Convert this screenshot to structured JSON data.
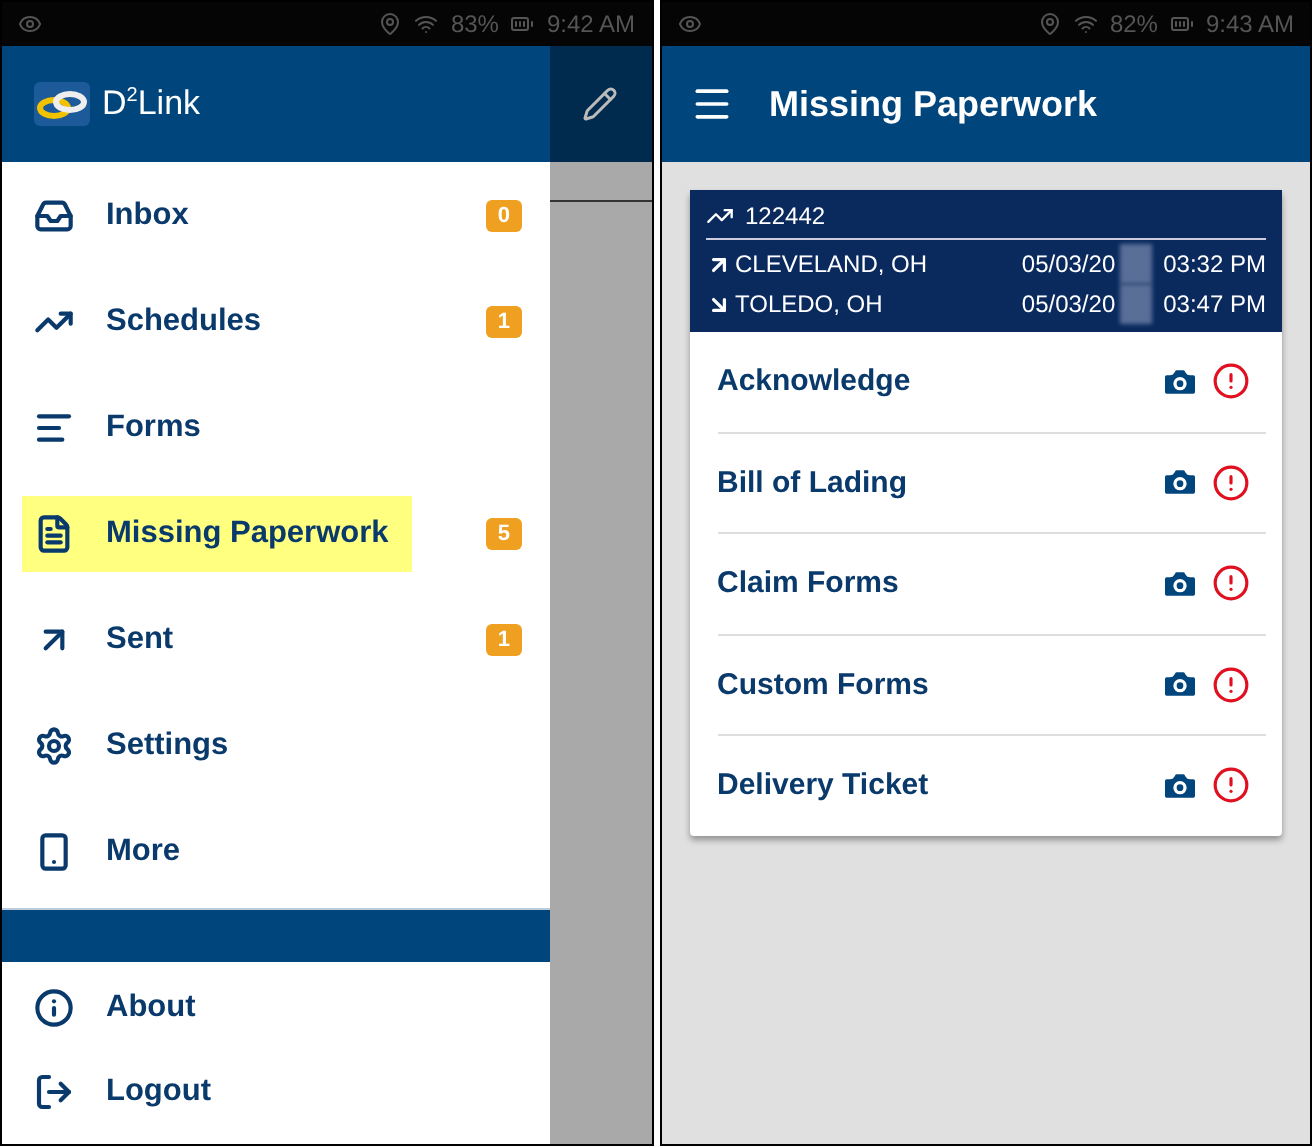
{
  "left_screen": {
    "status_bar": {
      "battery": "83%",
      "time": "9:42 AM"
    },
    "drawer": {
      "logo_text": "D$^{2}$Link",
      "items": [
        {
          "label": "Inbox",
          "badge": "0",
          "selected": false
        },
        {
          "label": "Schedules",
          "badge": "1",
          "selected": false
        },
        {
          "label": "Forms",
          "selected": false
        },
        {
          "label": "Missing Paperwork",
          "badge": "5",
          "selected": true
        },
        {
          "label": "Sent",
          "badge": "1",
          "selected": false
        },
        {
          "label": "Settings",
          "selected": false
        },
        {
          "label": "More",
          "selected": false
        }
      ],
      "footer_items": [
        {
          "label": "About"
        },
        {
          "label": "Logout"
        }
      ]
    }
  },
  "right_screen": {
    "status_bar": {
      "battery": "82%",
      "time": "9:43 AM"
    },
    "title": "Missing Paperwork",
    "load": {
      "number": "122442",
      "stops": [
        {
          "kind": "pickup",
          "city": "CLEVELAND, OH",
          "date": "05/03/20",
          "time": "03:32 PM"
        },
        {
          "kind": "delivery",
          "city": "TOLEDO, OH",
          "date": "05/03/20",
          "time": "03:47 PM"
        }
      ]
    },
    "documents": [
      {
        "label": "Acknowledge"
      },
      {
        "label": "Bill of Lading"
      },
      {
        "label": "Claim Forms"
      },
      {
        "label": "Custom Forms"
      },
      {
        "label": "Delivery Ticket"
      }
    ]
  }
}
